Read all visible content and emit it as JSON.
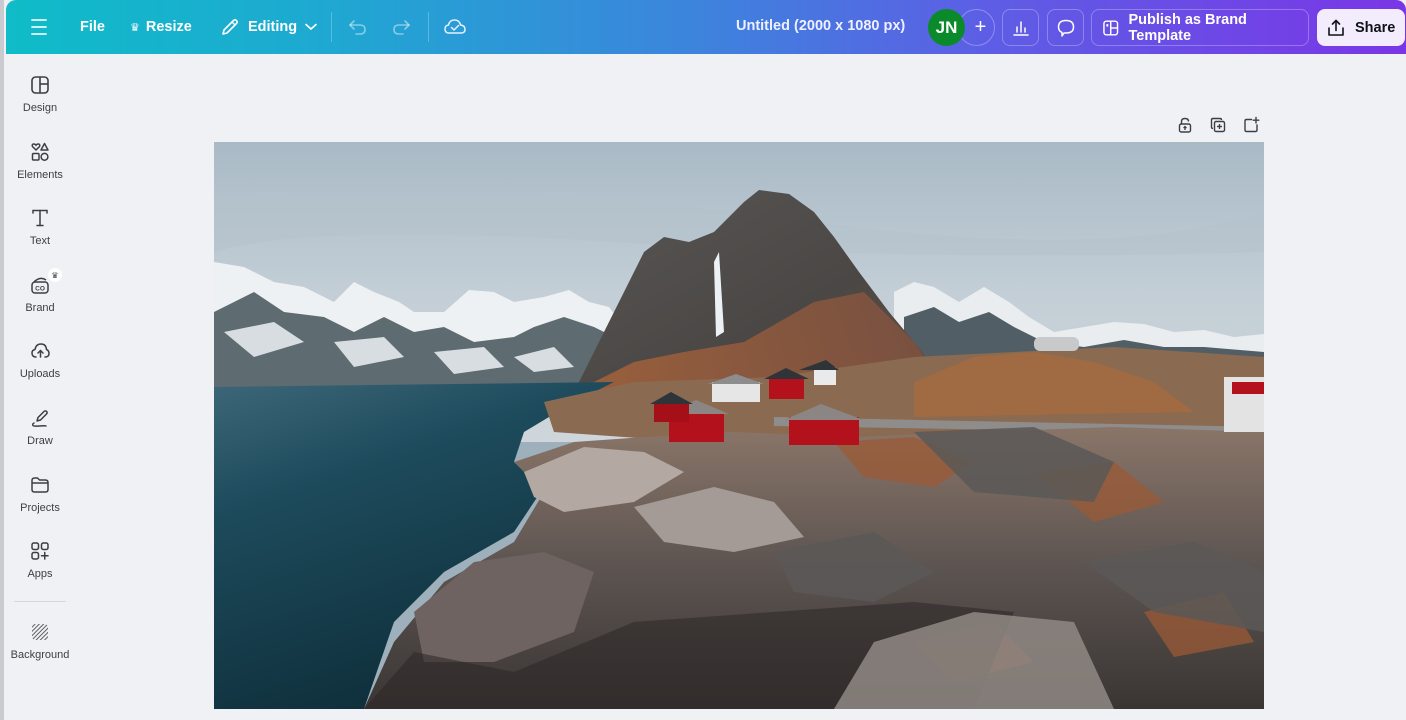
{
  "topbar": {
    "menu_icon": "hamburger-menu-icon",
    "file_label": "File",
    "resize_label": "Resize",
    "resize_badge_icon": "crown-icon",
    "editing_label": "Editing",
    "editing_icon": "pencil-icon",
    "undo_icon": "undo-icon",
    "redo_icon": "redo-icon",
    "save_status_icon": "cloud-check-icon",
    "document_title": "Untitled (2000 x 1080 px)",
    "avatar_initials": "JN",
    "add_member_label": "+",
    "insights_icon": "bar-chart-icon",
    "comments_icon": "speech-bubble-icon",
    "publish_label": "Publish as Brand Template",
    "publish_icon": "brand-template-icon",
    "share_label": "Share",
    "share_icon": "upload-share-icon",
    "gradient_colors": [
      "#0fbcc8",
      "#3b86dc",
      "#7a36e6"
    ],
    "avatar_color": "#0a8a2a"
  },
  "sidebar": {
    "items": [
      {
        "label": "Design",
        "icon": "layout-icon"
      },
      {
        "label": "Elements",
        "icon": "shapes-icon"
      },
      {
        "label": "Text",
        "icon": "text-t-icon"
      },
      {
        "label": "Brand",
        "icon": "brand-kit-icon",
        "badge": "crown-icon"
      },
      {
        "label": "Uploads",
        "icon": "cloud-upload-icon"
      },
      {
        "label": "Draw",
        "icon": "draw-pen-icon"
      },
      {
        "label": "Projects",
        "icon": "folder-icon"
      },
      {
        "label": "Apps",
        "icon": "apps-grid-icon"
      },
      {
        "label": "Background",
        "icon": "background-hatch-icon"
      }
    ]
  },
  "canvas": {
    "tools": [
      {
        "name": "lock-page",
        "icon": "lock-icon"
      },
      {
        "name": "duplicate-page",
        "icon": "duplicate-icon"
      },
      {
        "name": "add-page",
        "icon": "add-page-icon"
      }
    ],
    "page_image": {
      "description": "Landscape photo of red fishing cabins on a rocky coast with snow-capped mountains and a fjord",
      "colors": {
        "sky": "#b9c7d0",
        "water": "#17414f",
        "cabin_red": "#b3111c",
        "rock": "#6f6c6a",
        "rust": "#b5672f",
        "snow": "#eef1f3"
      }
    }
  }
}
